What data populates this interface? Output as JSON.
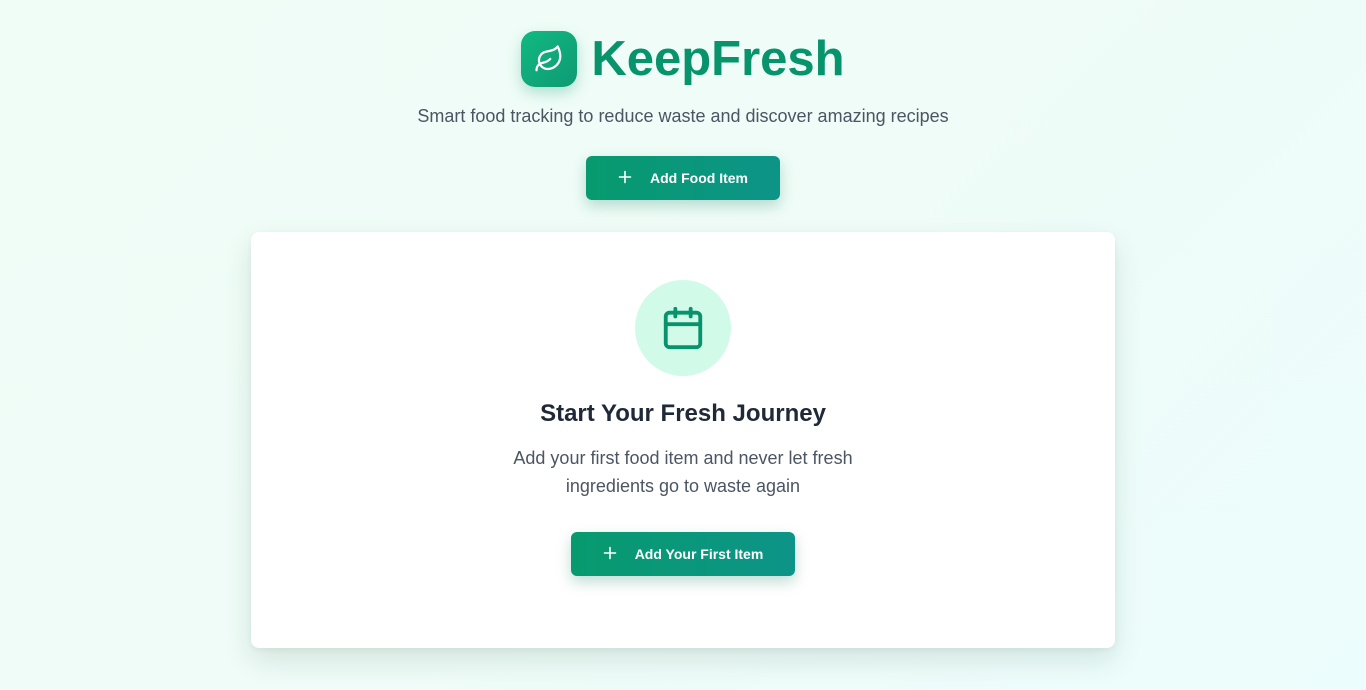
{
  "app": {
    "title": "KeepFresh",
    "tagline": "Smart food tracking to reduce waste and discover amazing recipes",
    "logo_icon": "leaf-icon"
  },
  "header": {
    "add_button_label": "Add Food Item",
    "add_button_icon": "plus-icon"
  },
  "empty_state": {
    "icon": "calendar-icon",
    "title": "Start Your Fresh Journey",
    "description": "Add your first food item and never let fresh ingredients go to waste again",
    "button_label": "Add Your First Item",
    "button_icon": "plus-icon"
  },
  "colors": {
    "brand": "#07936b",
    "accent_gradient_start": "#079a6e",
    "accent_gradient_end": "#0d9488",
    "icon_circle_bg": "#d1fae9",
    "page_bg": "#f0fdf7"
  }
}
